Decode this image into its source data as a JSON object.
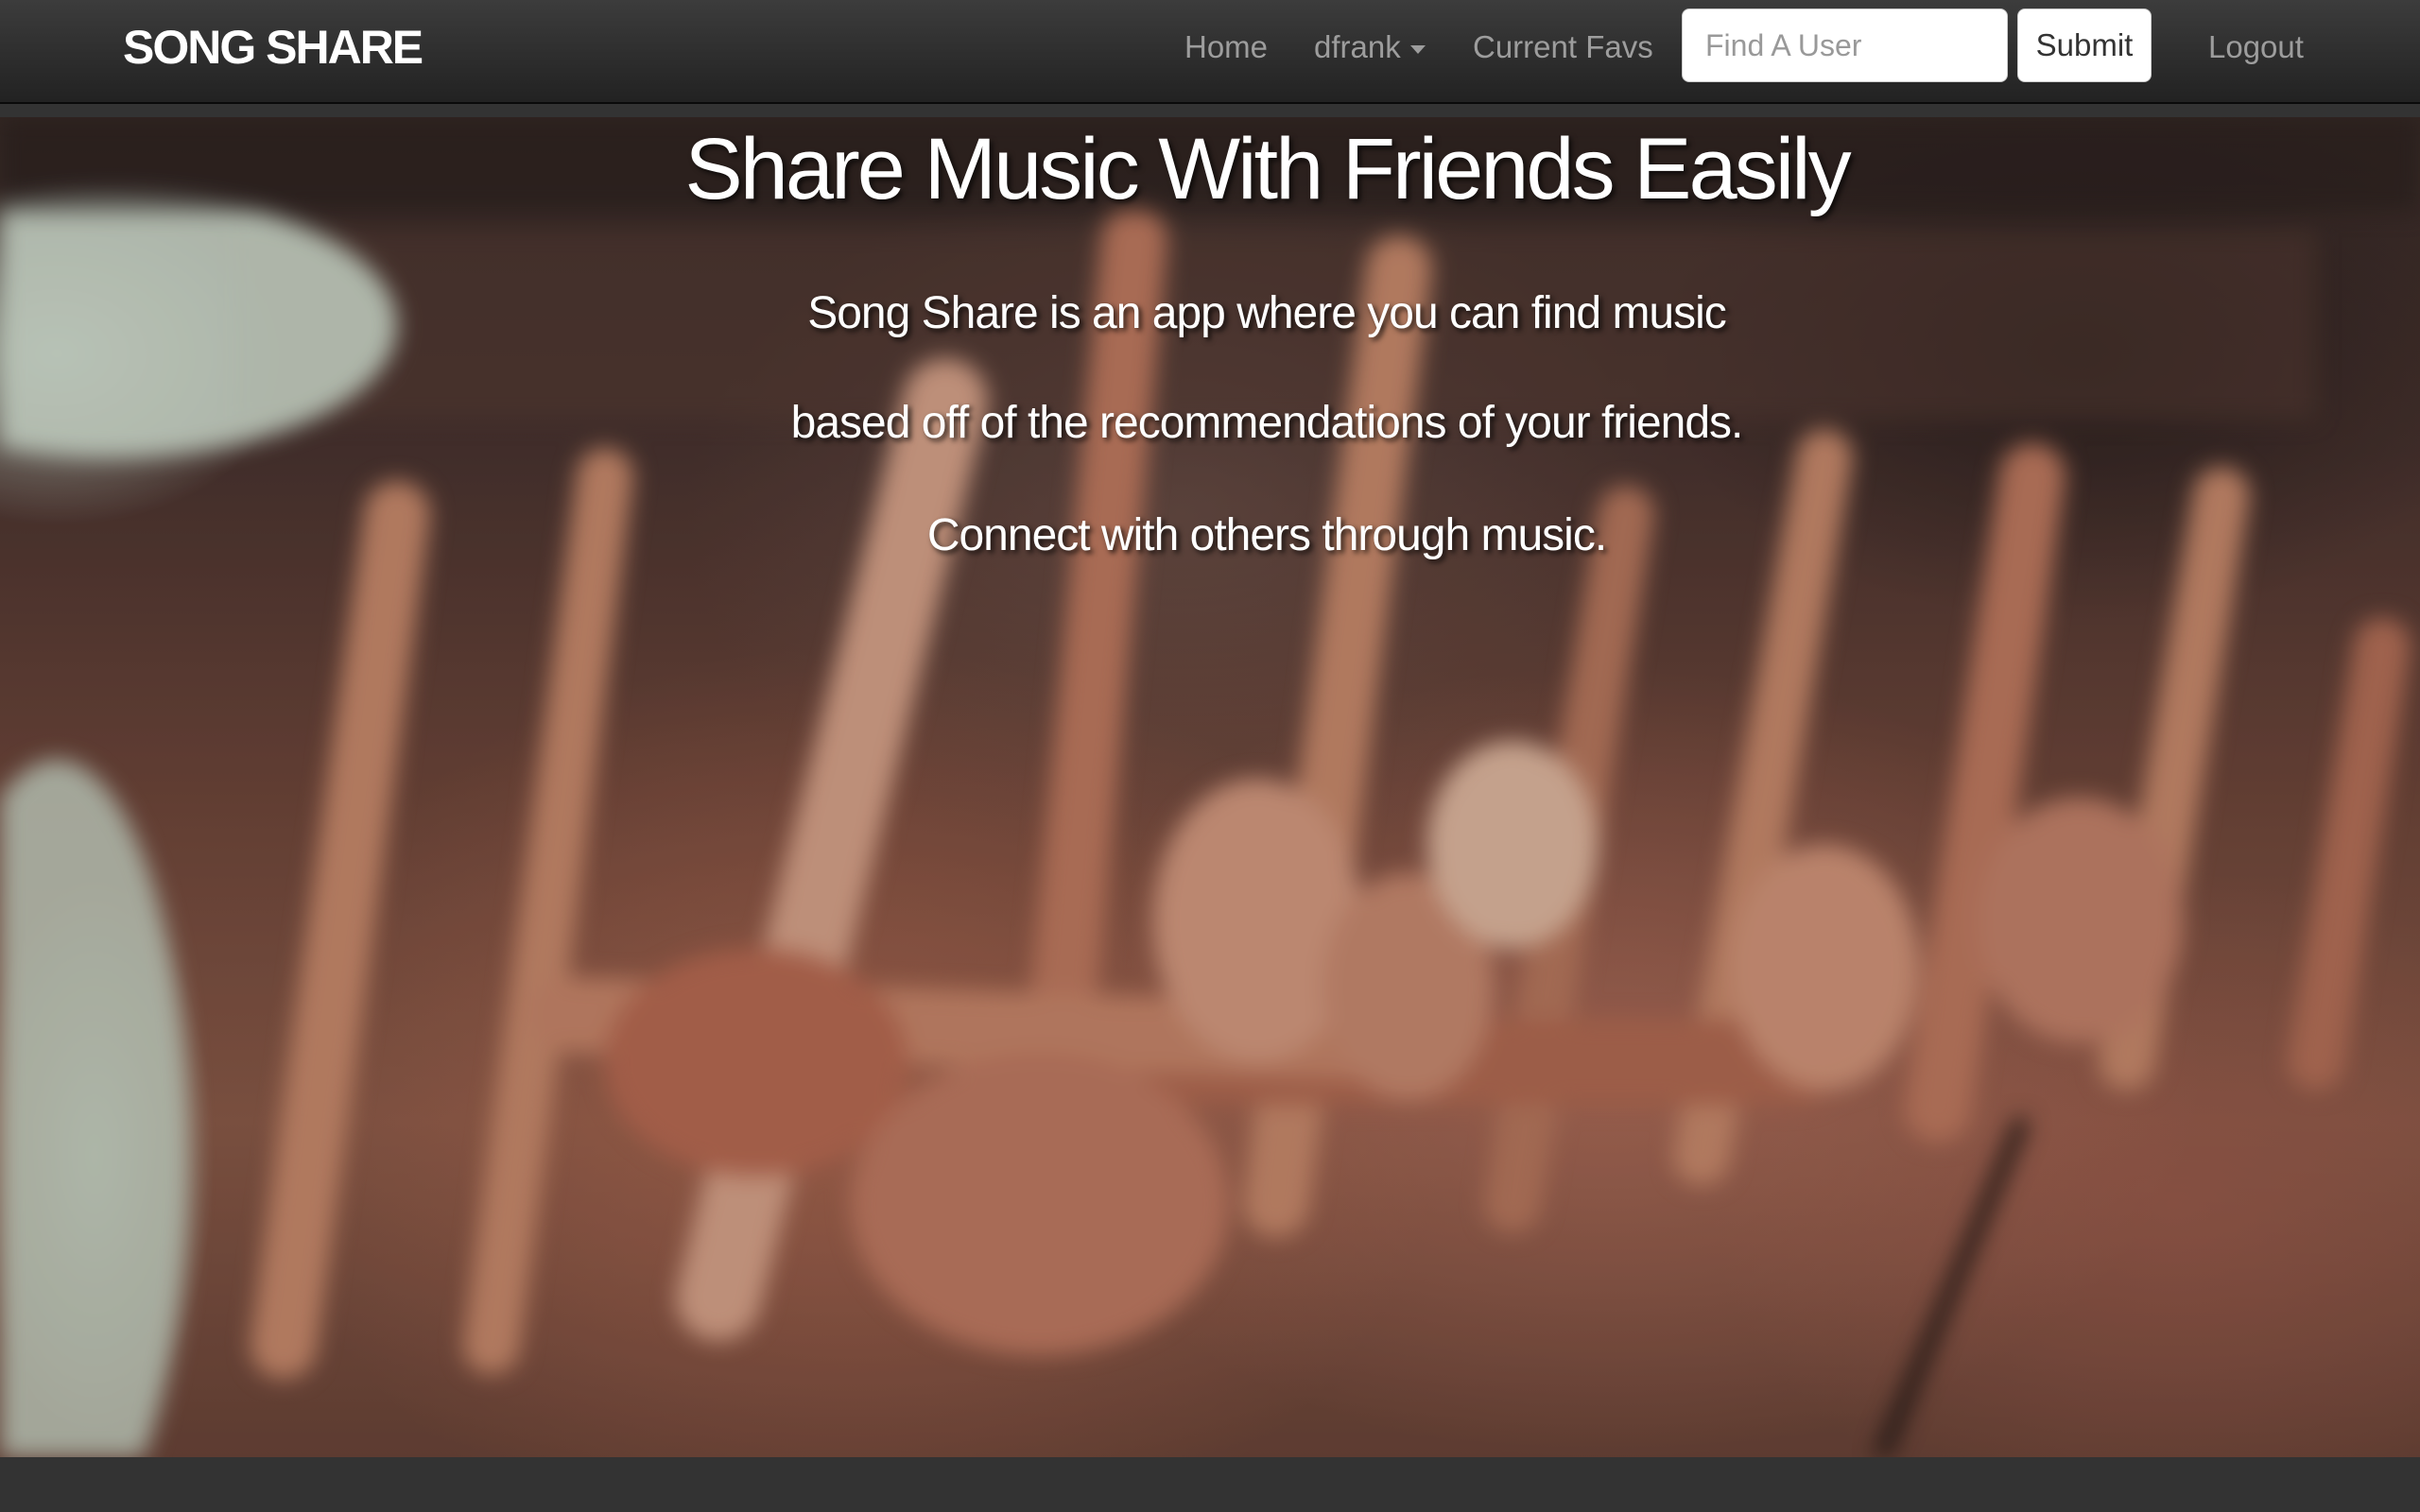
{
  "navbar": {
    "brand": "SONG SHARE",
    "links": {
      "home": "Home",
      "user": "dfrank",
      "favs": "Current Favs",
      "logout": "Logout"
    },
    "search": {
      "placeholder": "Find A User",
      "value": ""
    },
    "submit_label": "Submit"
  },
  "hero": {
    "title": "Share Music With Friends Easily",
    "lines": [
      "Song Share is an app where you can find music",
      "based off of the recommendations of your friends.",
      "Connect with others through music."
    ]
  },
  "colors": {
    "navbar_bg": "#222222",
    "nav_link": "#9d9d9d",
    "brand": "#ffffff",
    "footer_bg": "#333333"
  },
  "icons": {
    "user_dropdown": "caret-down-icon"
  }
}
